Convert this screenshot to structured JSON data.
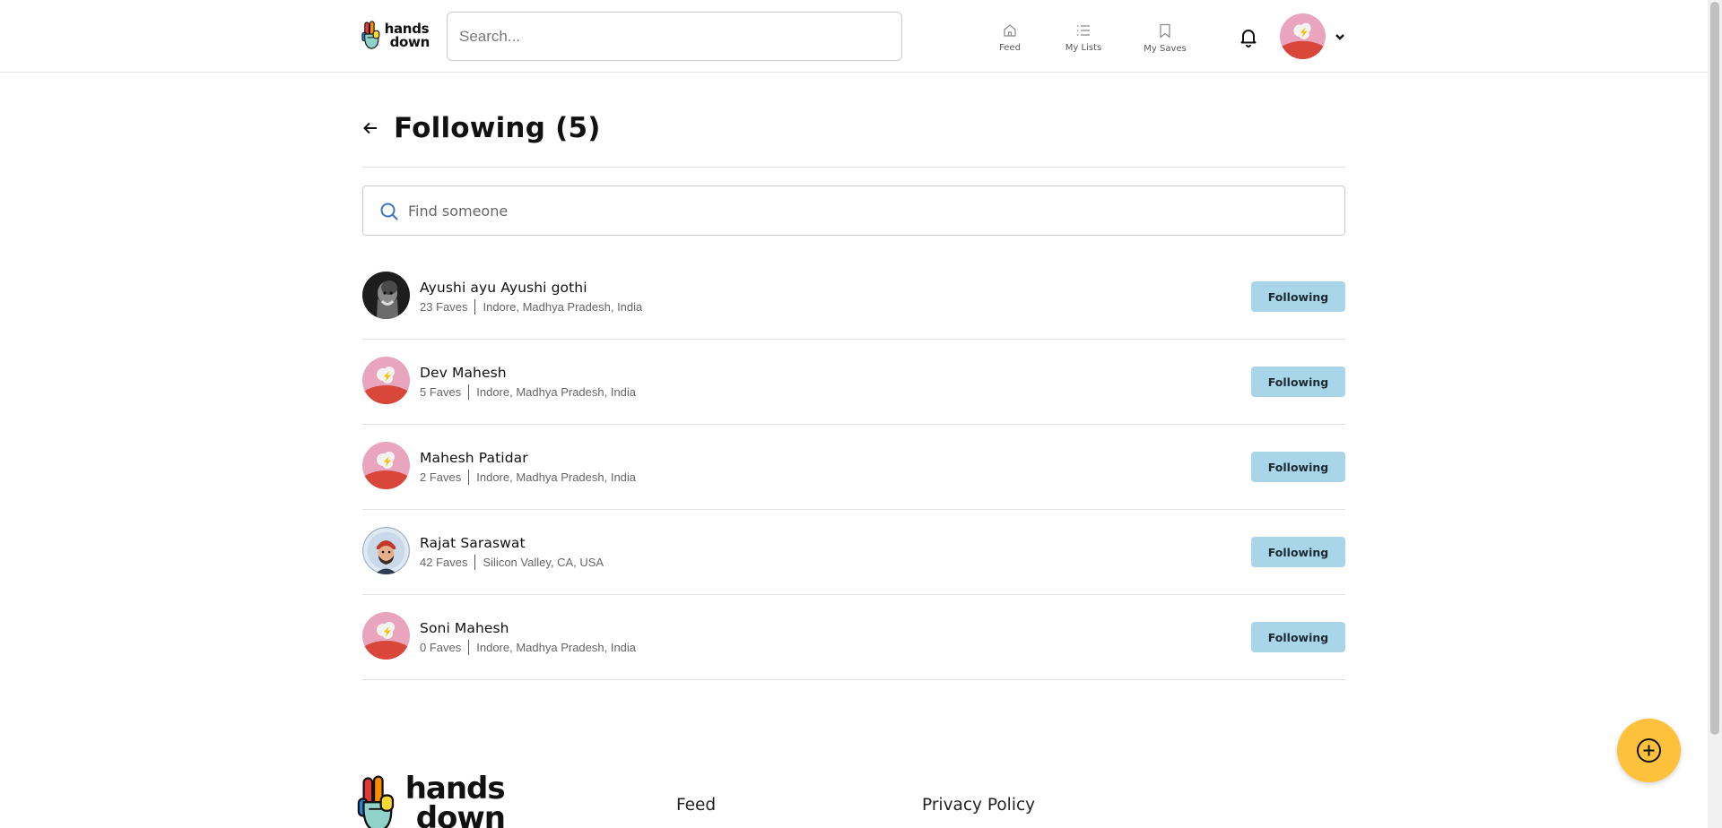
{
  "header": {
    "logo_text_line1": "hands",
    "logo_text_line2": "down",
    "search_placeholder": "Search...",
    "nav": [
      {
        "label": "Feed",
        "icon": "home-icon"
      },
      {
        "label": "My Lists",
        "icon": "list-icon"
      },
      {
        "label": "My Saves",
        "icon": "bookmark-icon"
      }
    ],
    "notifications_icon": "bell-icon",
    "profile_menu_icon": "chevron-down-icon"
  },
  "page": {
    "title": "Following (5)",
    "back_icon": "arrow-left-icon",
    "find_placeholder": "Find someone"
  },
  "following": [
    {
      "name": "Ayushi ayu Ayushi gothi",
      "faves": "23 Faves",
      "location": "Indore, Madhya Pradesh, India",
      "button": "Following",
      "avatar": "photo-bw"
    },
    {
      "name": "Dev Mahesh",
      "faves": "5 Faves",
      "location": "Indore, Madhya Pradesh, India",
      "button": "Following",
      "avatar": "default"
    },
    {
      "name": "Mahesh Patidar",
      "faves": "2 Faves",
      "location": "Indore, Madhya Pradesh, India",
      "button": "Following",
      "avatar": "default"
    },
    {
      "name": "Rajat Saraswat",
      "faves": "42 Faves",
      "location": "Silicon Valley, CA, USA",
      "button": "Following",
      "avatar": "cartoon"
    },
    {
      "name": "Soni Mahesh",
      "faves": "0 Faves",
      "location": "Indore, Madhya Pradesh, India",
      "button": "Following",
      "avatar": "default"
    }
  ],
  "footer": {
    "logo_text_line1": "hands",
    "logo_text_line2": "down",
    "links": [
      "Feed",
      "Privacy Policy"
    ]
  },
  "fab_icon": "plus-circle-icon",
  "colors": {
    "follow_button_bg": "#a9d5e9",
    "fab_bg": "#fdc13b",
    "default_avatar_bg": "#e8a5bd",
    "default_avatar_ground": "#d9463a"
  }
}
